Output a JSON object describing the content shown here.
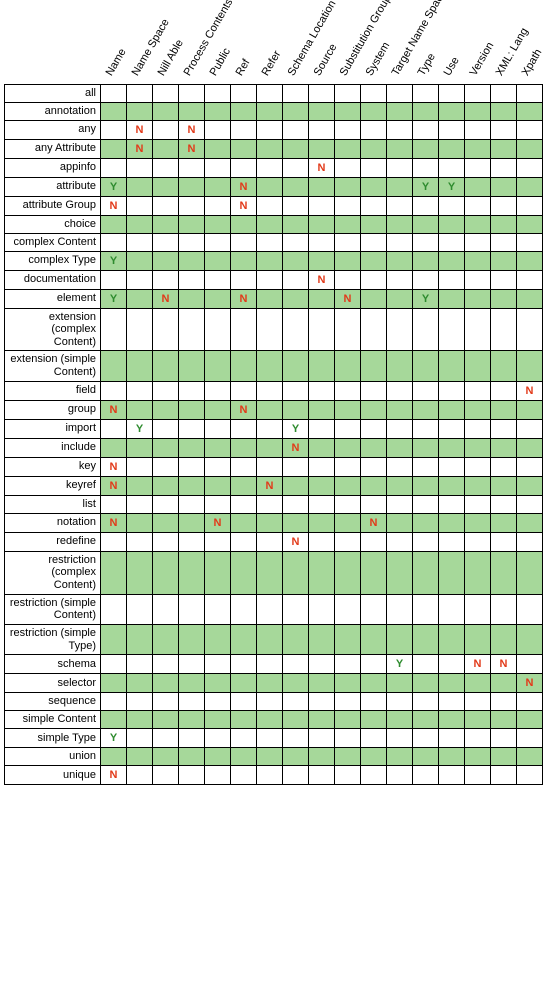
{
  "chart_data": {
    "type": "table",
    "title": "",
    "columns": [
      "Name",
      "Name Space",
      "Nill Able",
      "Process Contents",
      "Public",
      "Ref",
      "Refer",
      "Schema Location",
      "Source",
      "Substitution Group",
      "System",
      "Target Name Space",
      "Type",
      "Use",
      "Version",
      "XML: Lang",
      "Xpath"
    ],
    "rows": [
      {
        "label": "all",
        "shade": false,
        "cells": [
          "",
          "",
          "",
          "",
          "",
          "",
          "",
          "",
          "",
          "",
          "",
          "",
          "",
          "",
          "",
          "",
          ""
        ]
      },
      {
        "label": "annotation",
        "shade": true,
        "cells": [
          "",
          "",
          "",
          "",
          "",
          "",
          "",
          "",
          "",
          "",
          "",
          "",
          "",
          "",
          "",
          "",
          ""
        ]
      },
      {
        "label": "any",
        "shade": false,
        "cells": [
          "",
          "N",
          "",
          "N",
          "",
          "",
          "",
          "",
          "",
          "",
          "",
          "",
          "",
          "",
          "",
          "",
          ""
        ]
      },
      {
        "label": "any Attribute",
        "shade": true,
        "cells": [
          "",
          "N",
          "",
          "N",
          "",
          "",
          "",
          "",
          "",
          "",
          "",
          "",
          "",
          "",
          "",
          "",
          ""
        ]
      },
      {
        "label": "appinfo",
        "shade": false,
        "cells": [
          "",
          "",
          "",
          "",
          "",
          "",
          "",
          "",
          "N",
          "",
          "",
          "",
          "",
          "",
          "",
          "",
          ""
        ]
      },
      {
        "label": "attribute",
        "shade": true,
        "cells": [
          "Y",
          "",
          "",
          "",
          "",
          "N",
          "",
          "",
          "",
          "",
          "",
          "",
          "Y",
          "Y",
          "",
          "",
          ""
        ]
      },
      {
        "label": "attribute Group",
        "shade": false,
        "cells": [
          "N",
          "",
          "",
          "",
          "",
          "N",
          "",
          "",
          "",
          "",
          "",
          "",
          "",
          "",
          "",
          "",
          ""
        ]
      },
      {
        "label": "choice",
        "shade": true,
        "cells": [
          "",
          "",
          "",
          "",
          "",
          "",
          "",
          "",
          "",
          "",
          "",
          "",
          "",
          "",
          "",
          "",
          ""
        ]
      },
      {
        "label": "complex Content",
        "shade": false,
        "cells": [
          "",
          "",
          "",
          "",
          "",
          "",
          "",
          "",
          "",
          "",
          "",
          "",
          "",
          "",
          "",
          "",
          ""
        ]
      },
      {
        "label": "complex Type",
        "shade": true,
        "cells": [
          "Y",
          "",
          "",
          "",
          "",
          "",
          "",
          "",
          "",
          "",
          "",
          "",
          "",
          "",
          "",
          "",
          ""
        ]
      },
      {
        "label": "documentation",
        "shade": false,
        "cells": [
          "",
          "",
          "",
          "",
          "",
          "",
          "",
          "",
          "N",
          "",
          "",
          "",
          "",
          "",
          "",
          "",
          ""
        ]
      },
      {
        "label": "element",
        "shade": true,
        "cells": [
          "Y",
          "",
          "N",
          "",
          "",
          "N",
          "",
          "",
          "",
          "N",
          "",
          "",
          "Y",
          "",
          "",
          "",
          ""
        ]
      },
      {
        "label": "extension (complex Content)",
        "shade": false,
        "cells": [
          "",
          "",
          "",
          "",
          "",
          "",
          "",
          "",
          "",
          "",
          "",
          "",
          "",
          "",
          "",
          "",
          ""
        ]
      },
      {
        "label": "extension (simple Content)",
        "shade": true,
        "cells": [
          "",
          "",
          "",
          "",
          "",
          "",
          "",
          "",
          "",
          "",
          "",
          "",
          "",
          "",
          "",
          "",
          ""
        ]
      },
      {
        "label": "field",
        "shade": false,
        "cells": [
          "",
          "",
          "",
          "",
          "",
          "",
          "",
          "",
          "",
          "",
          "",
          "",
          "",
          "",
          "",
          "",
          "N"
        ]
      },
      {
        "label": "group",
        "shade": true,
        "cells": [
          "N",
          "",
          "",
          "",
          "",
          "N",
          "",
          "",
          "",
          "",
          "",
          "",
          "",
          "",
          "",
          "",
          ""
        ]
      },
      {
        "label": "import",
        "shade": false,
        "cells": [
          "",
          "Y",
          "",
          "",
          "",
          "",
          "",
          "Y",
          "",
          "",
          "",
          "",
          "",
          "",
          "",
          "",
          ""
        ]
      },
      {
        "label": "include",
        "shade": true,
        "cells": [
          "",
          "",
          "",
          "",
          "",
          "",
          "",
          "N",
          "",
          "",
          "",
          "",
          "",
          "",
          "",
          "",
          ""
        ]
      },
      {
        "label": "key",
        "shade": false,
        "cells": [
          "N",
          "",
          "",
          "",
          "",
          "",
          "",
          "",
          "",
          "",
          "",
          "",
          "",
          "",
          "",
          "",
          ""
        ]
      },
      {
        "label": "keyref",
        "shade": true,
        "cells": [
          "N",
          "",
          "",
          "",
          "",
          "",
          "N",
          "",
          "",
          "",
          "",
          "",
          "",
          "",
          "",
          "",
          ""
        ]
      },
      {
        "label": "list",
        "shade": false,
        "cells": [
          "",
          "",
          "",
          "",
          "",
          "",
          "",
          "",
          "",
          "",
          "",
          "",
          "",
          "",
          "",
          "",
          ""
        ]
      },
      {
        "label": "notation",
        "shade": true,
        "cells": [
          "N",
          "",
          "",
          "",
          "N",
          "",
          "",
          "",
          "",
          "",
          "N",
          "",
          "",
          "",
          "",
          "",
          ""
        ]
      },
      {
        "label": "redefine",
        "shade": false,
        "cells": [
          "",
          "",
          "",
          "",
          "",
          "",
          "",
          "N",
          "",
          "",
          "",
          "",
          "",
          "",
          "",
          "",
          ""
        ]
      },
      {
        "label": "restriction (complex Content)",
        "shade": true,
        "cells": [
          "",
          "",
          "",
          "",
          "",
          "",
          "",
          "",
          "",
          "",
          "",
          "",
          "",
          "",
          "",
          "",
          ""
        ]
      },
      {
        "label": "restriction (simple Content)",
        "shade": false,
        "cells": [
          "",
          "",
          "",
          "",
          "",
          "",
          "",
          "",
          "",
          "",
          "",
          "",
          "",
          "",
          "",
          "",
          ""
        ]
      },
      {
        "label": "restriction (simple Type)",
        "shade": true,
        "cells": [
          "",
          "",
          "",
          "",
          "",
          "",
          "",
          "",
          "",
          "",
          "",
          "",
          "",
          "",
          "",
          "",
          ""
        ]
      },
      {
        "label": "schema",
        "shade": false,
        "cells": [
          "",
          "",
          "",
          "",
          "",
          "",
          "",
          "",
          "",
          "",
          "",
          "Y",
          "",
          "",
          "N",
          "N",
          ""
        ]
      },
      {
        "label": "selector",
        "shade": true,
        "cells": [
          "",
          "",
          "",
          "",
          "",
          "",
          "",
          "",
          "",
          "",
          "",
          "",
          "",
          "",
          "",
          "",
          "N"
        ]
      },
      {
        "label": "sequence",
        "shade": false,
        "cells": [
          "",
          "",
          "",
          "",
          "",
          "",
          "",
          "",
          "",
          "",
          "",
          "",
          "",
          "",
          "",
          "",
          ""
        ]
      },
      {
        "label": "simple Content",
        "shade": true,
        "cells": [
          "",
          "",
          "",
          "",
          "",
          "",
          "",
          "",
          "",
          "",
          "",
          "",
          "",
          "",
          "",
          "",
          ""
        ]
      },
      {
        "label": "simple Type",
        "shade": false,
        "cells": [
          "Y",
          "",
          "",
          "",
          "",
          "",
          "",
          "",
          "",
          "",
          "",
          "",
          "",
          "",
          "",
          "",
          ""
        ]
      },
      {
        "label": "union",
        "shade": true,
        "cells": [
          "",
          "",
          "",
          "",
          "",
          "",
          "",
          "",
          "",
          "",
          "",
          "",
          "",
          "",
          "",
          "",
          ""
        ]
      },
      {
        "label": "unique",
        "shade": false,
        "cells": [
          "N",
          "",
          "",
          "",
          "",
          "",
          "",
          "",
          "",
          "",
          "",
          "",
          "",
          "",
          "",
          "",
          ""
        ]
      }
    ],
    "legend": {
      "Y": "Y",
      "N": "N"
    }
  }
}
